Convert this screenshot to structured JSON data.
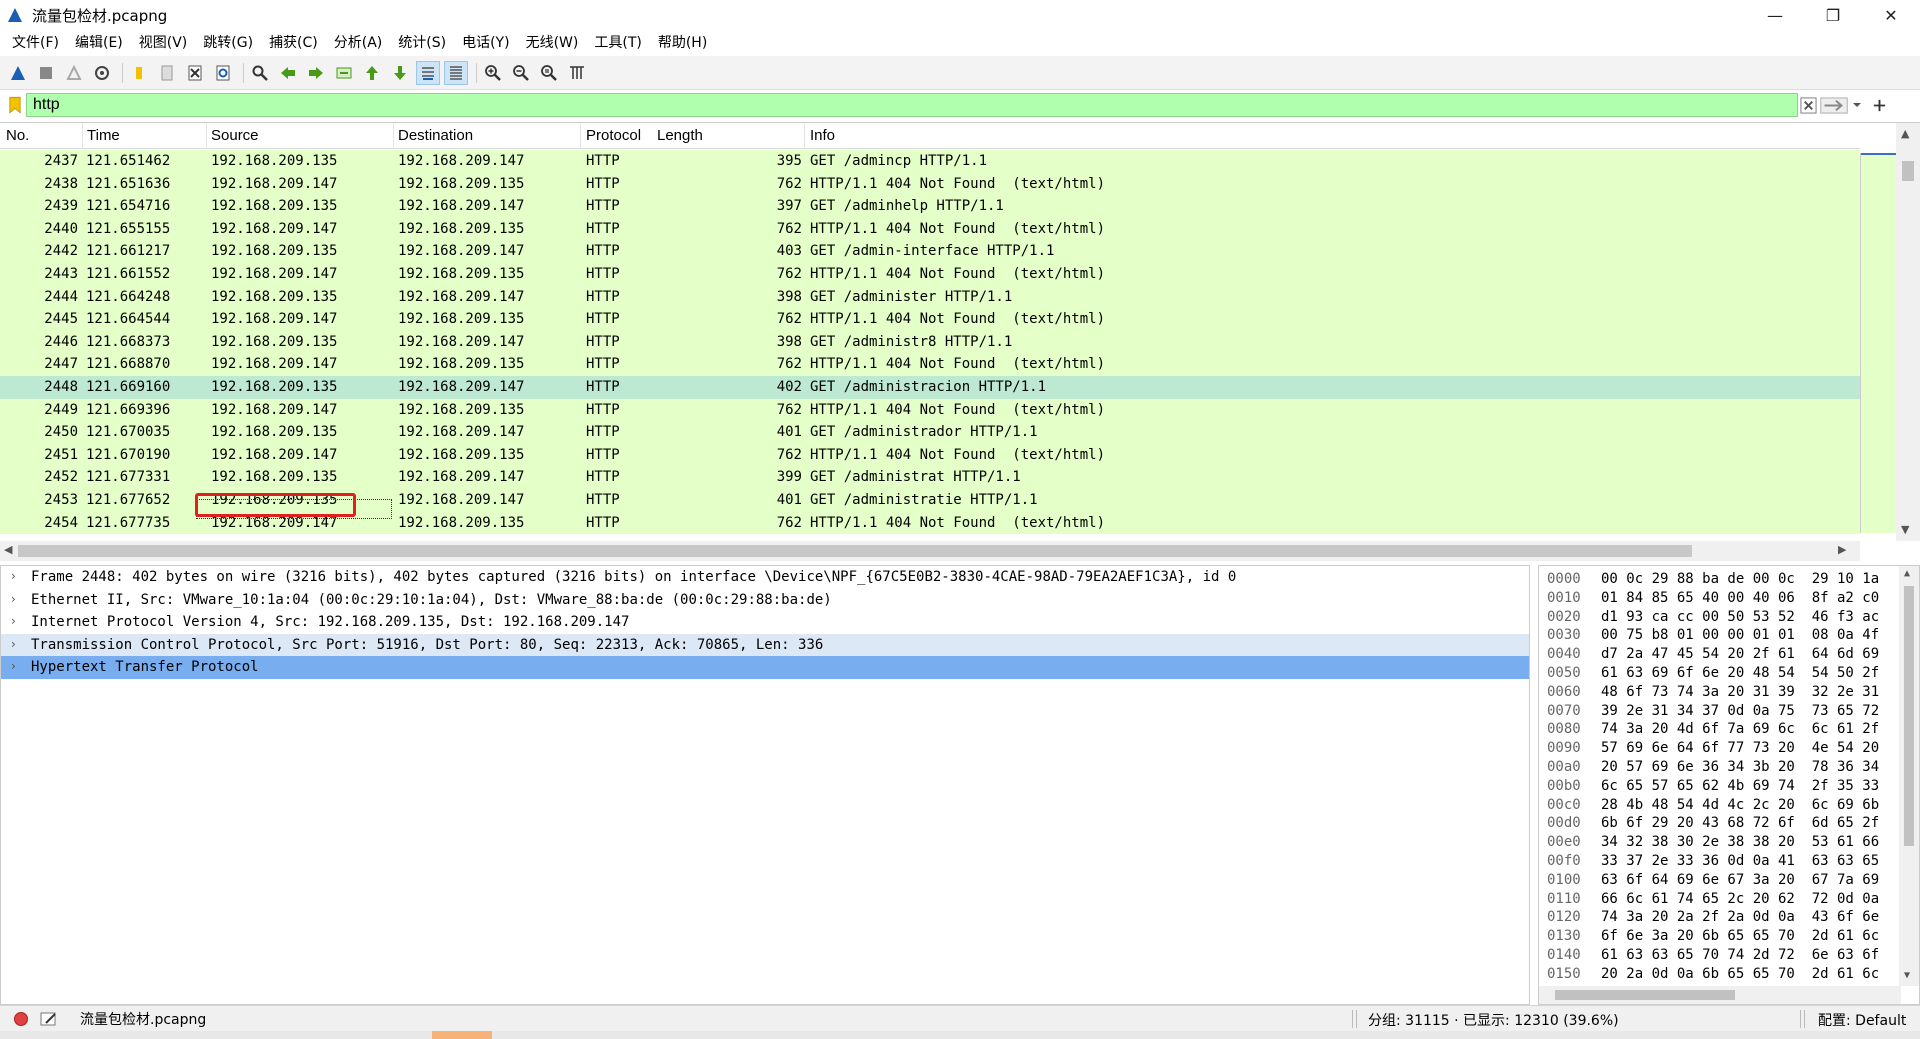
{
  "window": {
    "title": "流量包检材.pcapng",
    "controls": {
      "minimize": "—",
      "maximize": "❐",
      "close": "✕"
    }
  },
  "menu": [
    "文件(F)",
    "编辑(E)",
    "视图(V)",
    "跳转(G)",
    "捕获(C)",
    "分析(A)",
    "统计(S)",
    "电话(Y)",
    "无线(W)",
    "工具(T)",
    "帮助(H)"
  ],
  "toolbar": {
    "icons": [
      "shark-fin-start-icon",
      "stop-icon",
      "restart-icon",
      "capture-options-icon",
      "open-folder-icon",
      "save-file-icon",
      "close-file-icon",
      "reload-icon",
      "find-packet-icon",
      "back-arrow-icon",
      "forward-arrow-icon",
      "go-to-packet-icon",
      "first-packet-icon",
      "last-packet-icon",
      "auto-scroll-icon",
      "colorize-icon",
      "zoom-in-icon",
      "zoom-out-icon",
      "zoom-reset-icon",
      "resize-columns-icon"
    ]
  },
  "filter": {
    "value": "http",
    "color": "#afffaf"
  },
  "packet_list": {
    "columns": [
      "No.",
      "Time",
      "Source",
      "Destination",
      "Protocol",
      "Length",
      "Info"
    ],
    "rows": [
      {
        "no": "2437",
        "time": "121.651462",
        "src": "192.168.209.135",
        "dst": "192.168.209.147",
        "proto": "HTTP",
        "len": "395",
        "info": "GET /admincp HTTP/1.1"
      },
      {
        "no": "2438",
        "time": "121.651636",
        "src": "192.168.209.147",
        "dst": "192.168.209.135",
        "proto": "HTTP",
        "len": "762",
        "info": "HTTP/1.1 404 Not Found  (text/html)"
      },
      {
        "no": "2439",
        "time": "121.654716",
        "src": "192.168.209.135",
        "dst": "192.168.209.147",
        "proto": "HTTP",
        "len": "397",
        "info": "GET /adminhelp HTTP/1.1"
      },
      {
        "no": "2440",
        "time": "121.655155",
        "src": "192.168.209.147",
        "dst": "192.168.209.135",
        "proto": "HTTP",
        "len": "762",
        "info": "HTTP/1.1 404 Not Found  (text/html)"
      },
      {
        "no": "2442",
        "time": "121.661217",
        "src": "192.168.209.135",
        "dst": "192.168.209.147",
        "proto": "HTTP",
        "len": "403",
        "info": "GET /admin-interface HTTP/1.1"
      },
      {
        "no": "2443",
        "time": "121.661552",
        "src": "192.168.209.147",
        "dst": "192.168.209.135",
        "proto": "HTTP",
        "len": "762",
        "info": "HTTP/1.1 404 Not Found  (text/html)"
      },
      {
        "no": "2444",
        "time": "121.664248",
        "src": "192.168.209.135",
        "dst": "192.168.209.147",
        "proto": "HTTP",
        "len": "398",
        "info": "GET /administer HTTP/1.1"
      },
      {
        "no": "2445",
        "time": "121.664544",
        "src": "192.168.209.147",
        "dst": "192.168.209.135",
        "proto": "HTTP",
        "len": "762",
        "info": "HTTP/1.1 404 Not Found  (text/html)"
      },
      {
        "no": "2446",
        "time": "121.668373",
        "src": "192.168.209.135",
        "dst": "192.168.209.147",
        "proto": "HTTP",
        "len": "398",
        "info": "GET /administr8 HTTP/1.1"
      },
      {
        "no": "2447",
        "time": "121.668870",
        "src": "192.168.209.147",
        "dst": "192.168.209.135",
        "proto": "HTTP",
        "len": "762",
        "info": "HTTP/1.1 404 Not Found  (text/html)"
      },
      {
        "no": "2448",
        "time": "121.669160",
        "src": "192.168.209.135",
        "dst": "192.168.209.147",
        "proto": "HTTP",
        "len": "402",
        "info": "GET /administracion HTTP/1.1"
      },
      {
        "no": "2449",
        "time": "121.669396",
        "src": "192.168.209.147",
        "dst": "192.168.209.135",
        "proto": "HTTP",
        "len": "762",
        "info": "HTTP/1.1 404 Not Found  (text/html)"
      },
      {
        "no": "2450",
        "time": "121.670035",
        "src": "192.168.209.135",
        "dst": "192.168.209.147",
        "proto": "HTTP",
        "len": "401",
        "info": "GET /administrador HTTP/1.1"
      },
      {
        "no": "2451",
        "time": "121.670190",
        "src": "192.168.209.147",
        "dst": "192.168.209.135",
        "proto": "HTTP",
        "len": "762",
        "info": "HTTP/1.1 404 Not Found  (text/html)"
      },
      {
        "no": "2452",
        "time": "121.677331",
        "src": "192.168.209.135",
        "dst": "192.168.209.147",
        "proto": "HTTP",
        "len": "399",
        "info": "GET /administrat HTTP/1.1"
      },
      {
        "no": "2453",
        "time": "121.677652",
        "src": "192.168.209.135",
        "dst": "192.168.209.147",
        "proto": "HTTP",
        "len": "401",
        "info": "GET /administratie HTTP/1.1"
      },
      {
        "no": "2454",
        "time": "121.677735",
        "src": "192.168.209.147",
        "dst": "192.168.209.135",
        "proto": "HTTP",
        "len": "762",
        "info": "HTTP/1.1 404 Not Found  (text/html)"
      }
    ],
    "row_color": "#e4ffc7",
    "selected_color": "#bde8d2",
    "selected_no": "2448"
  },
  "details": [
    {
      "text": "Frame 2448: 402 bytes on wire (3216 bits), 402 bytes captured (3216 bits) on interface \\Device\\NPF_{67C5E0B2-3830-4CAE-98AD-79EA2AEF1C3A}, id 0",
      "state": ""
    },
    {
      "text": "Ethernet II, Src: VMware_10:1a:04 (00:0c:29:10:1a:04), Dst: VMware_88:ba:de (00:0c:29:88:ba:de)",
      "state": ""
    },
    {
      "text": "Internet Protocol Version 4, Src: 192.168.209.135, Dst: 192.168.209.147",
      "state": ""
    },
    {
      "text": "Transmission Control Protocol, Src Port: 51916, Dst Port: 80, Seq: 22313, Ack: 70865, Len: 336",
      "state": "hover"
    },
    {
      "text": "Hypertext Transfer Protocol",
      "state": "selected"
    }
  ],
  "bytes": [
    {
      "off": "0000",
      "hex": "00 0c 29 88 ba de 00 0c  29 10 1a"
    },
    {
      "off": "0010",
      "hex": "01 84 85 65 40 00 40 06  8f a2 c0"
    },
    {
      "off": "0020",
      "hex": "d1 93 ca cc 00 50 53 52  46 f3 ac"
    },
    {
      "off": "0030",
      "hex": "00 75 b8 01 00 00 01 01  08 0a 4f"
    },
    {
      "off": "0040",
      "hex": "d7 2a 47 45 54 20 2f 61  64 6d 69"
    },
    {
      "off": "0050",
      "hex": "61 63 69 6f 6e 20 48 54  54 50 2f"
    },
    {
      "off": "0060",
      "hex": "48 6f 73 74 3a 20 31 39  32 2e 31"
    },
    {
      "off": "0070",
      "hex": "39 2e 31 34 37 0d 0a 75  73 65 72"
    },
    {
      "off": "0080",
      "hex": "74 3a 20 4d 6f 7a 69 6c  6c 61 2f"
    },
    {
      "off": "0090",
      "hex": "57 69 6e 64 6f 77 73 20  4e 54 20"
    },
    {
      "off": "00a0",
      "hex": "20 57 69 6e 36 34 3b 20  78 36 34"
    },
    {
      "off": "00b0",
      "hex": "6c 65 57 65 62 4b 69 74  2f 35 33"
    },
    {
      "off": "00c0",
      "hex": "28 4b 48 54 4d 4c 2c 20  6c 69 6b"
    },
    {
      "off": "00d0",
      "hex": "6b 6f 29 20 43 68 72 6f  6d 65 2f"
    },
    {
      "off": "00e0",
      "hex": "34 32 38 30 2e 38 38 20  53 61 66"
    },
    {
      "off": "00f0",
      "hex": "33 37 2e 33 36 0d 0a 41  63 63 65"
    },
    {
      "off": "0100",
      "hex": "63 6f 64 69 6e 67 3a 20  67 7a 69"
    },
    {
      "off": "0110",
      "hex": "66 6c 61 74 65 2c 20 62  72 0d 0a"
    },
    {
      "off": "0120",
      "hex": "74 3a 20 2a 2f 2a 0d 0a  43 6f 6e"
    },
    {
      "off": "0130",
      "hex": "6f 6e 3a 20 6b 65 65 70  2d 61 6c"
    },
    {
      "off": "0140",
      "hex": "61 63 63 65 70 74 2d 72  6e 63 6f"
    },
    {
      "off": "0150",
      "hex": "20 2a 0d 0a 6b 65 65 70  2d 61 6c"
    }
  ],
  "status": {
    "file": "流量包检材.pcapng",
    "stats": "分组: 31115 · 已显示: 12310 (39.6%)",
    "profile": "配置: Default"
  }
}
